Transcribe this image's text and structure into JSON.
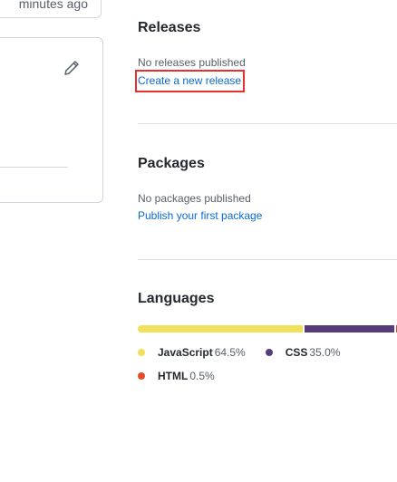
{
  "left_panel": {
    "updated_text": "minutes ago"
  },
  "releases": {
    "heading": "Releases",
    "empty_text": "No releases published",
    "create_link": "Create a new release"
  },
  "packages": {
    "heading": "Packages",
    "empty_text": "No packages published",
    "publish_link": "Publish your first package"
  },
  "languages": {
    "heading": "Languages",
    "items": [
      {
        "name": "JavaScript",
        "percent": "64.5%",
        "value": 64.5,
        "color": "#f1e05a"
      },
      {
        "name": "CSS",
        "percent": "35.0%",
        "value": 35.0,
        "color": "#563d7c"
      },
      {
        "name": "HTML",
        "percent": "0.5%",
        "value": 0.5,
        "color": "#e34c26"
      }
    ]
  },
  "colors": {
    "highlight_box": "#e5302e",
    "link": "#0969da"
  }
}
